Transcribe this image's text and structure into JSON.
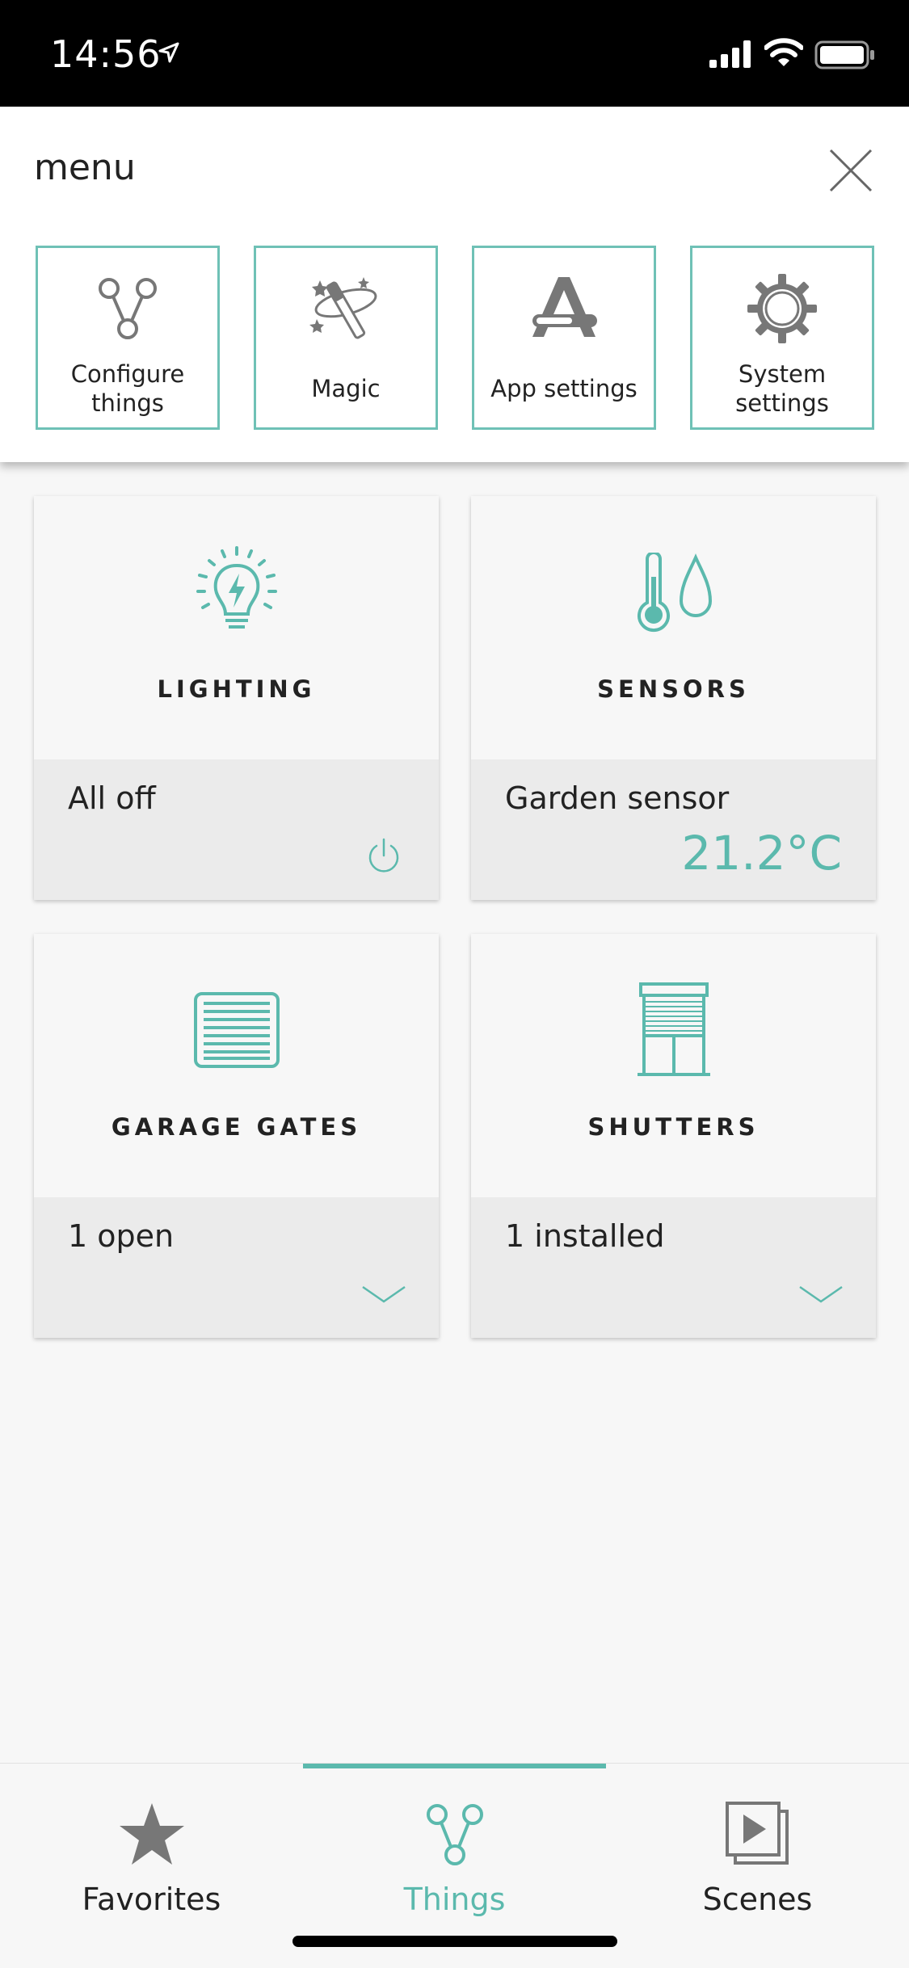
{
  "status_bar": {
    "time": "14:56"
  },
  "menu": {
    "title": "menu",
    "tiles": [
      {
        "label": "Configure things",
        "icon": "network-icon"
      },
      {
        "label": "Magic",
        "icon": "magic-wand-icon"
      },
      {
        "label": "App settings",
        "icon": "app-settings-icon"
      },
      {
        "label": "System settings",
        "icon": "gear-icon"
      }
    ]
  },
  "cards": [
    {
      "title": "LIGHTING",
      "status": "All off",
      "icon": "lightbulb-icon",
      "action": "power-icon"
    },
    {
      "title": "SENSORS",
      "status": "Garden sensor",
      "value": "21.2°C",
      "icon": "thermometer-drop-icon"
    },
    {
      "title": "GARAGE GATES",
      "status": "1 open",
      "icon": "garage-gate-icon",
      "action": "chevron-down-icon"
    },
    {
      "title": "SHUTTERS",
      "status": "1 installed",
      "icon": "shutter-icon",
      "action": "chevron-down-icon"
    }
  ],
  "tab_bar": {
    "tabs": [
      {
        "label": "Favorites",
        "icon": "star-icon",
        "active": false
      },
      {
        "label": "Things",
        "icon": "network-icon",
        "active": true
      },
      {
        "label": "Scenes",
        "icon": "scenes-icon",
        "active": false
      }
    ]
  },
  "colors": {
    "accent": "#5bb9ad",
    "icon_gray": "#777777",
    "text": "#222222"
  }
}
